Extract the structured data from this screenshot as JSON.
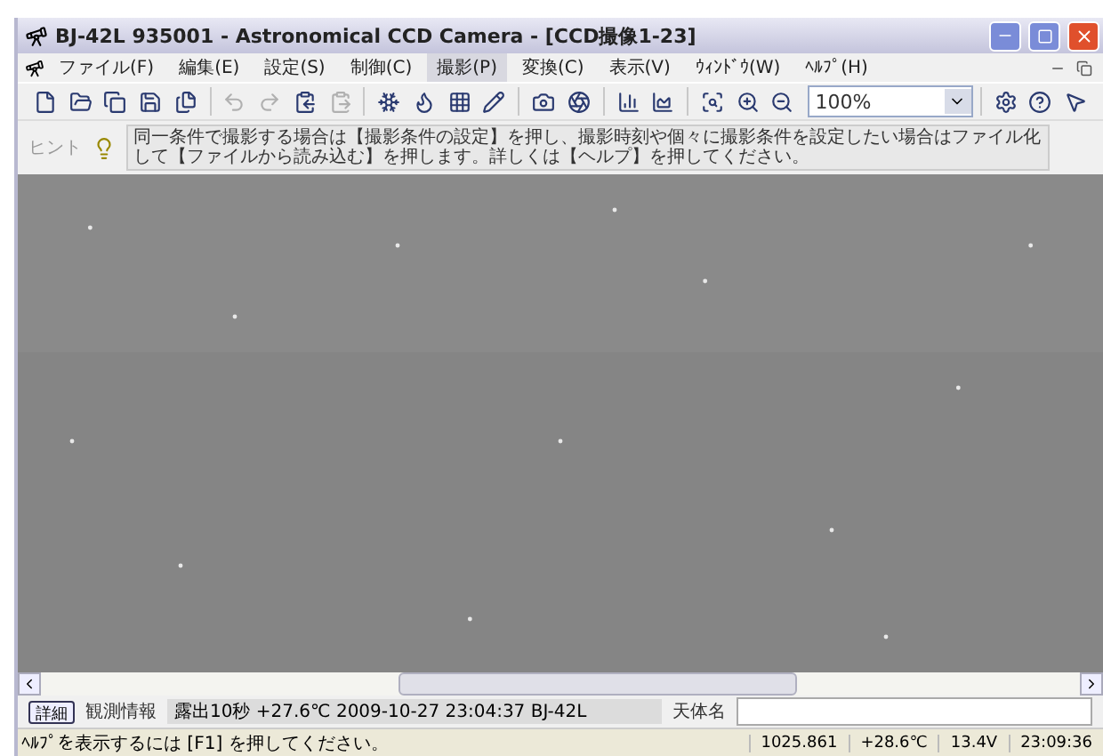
{
  "window": {
    "title": "BJ-42L 935001 - Astronomical CCD Camera - [CCD撮像1-23]"
  },
  "menu": [
    {
      "label": "ファイル(F)",
      "selected": false
    },
    {
      "label": "編集(E)",
      "selected": false
    },
    {
      "label": "設定(S)",
      "selected": false
    },
    {
      "label": "制御(C)",
      "selected": false
    },
    {
      "label": "撮影(P)",
      "selected": true
    },
    {
      "label": "変換(C)",
      "selected": false
    },
    {
      "label": "表示(V)",
      "selected": false
    },
    {
      "label": "ｳｨﾝﾄﾞｳ(W)",
      "selected": false
    },
    {
      "label": "ﾍﾙﾌﾟ(H)",
      "selected": false
    }
  ],
  "toolbar": {
    "buttons": [
      {
        "disabled": false
      },
      {
        "disabled": false
      },
      {
        "disabled": false
      },
      {
        "disabled": false
      },
      {
        "disabled": false
      },
      {
        "disabled": true
      },
      {
        "disabled": true
      },
      {
        "disabled": false
      },
      {
        "disabled": true
      },
      {
        "disabled": false
      },
      {
        "disabled": false
      },
      {
        "disabled": false
      },
      {
        "disabled": false
      },
      {
        "disabled": false
      },
      {
        "disabled": false
      },
      {
        "disabled": false
      },
      {
        "disabled": false
      },
      {
        "disabled": false
      },
      {
        "disabled": false
      },
      {
        "disabled": false
      }
    ],
    "zoom": "100%"
  },
  "hint": {
    "label": "ヒント",
    "text": "同一条件で撮影する場合は【撮影条件の設定】を押し、撮影時刻や個々に撮影条件を設定したい場合はファイル化して【ファイルから読み込む】を押します。詳しくは【ヘルプ】を押してください。"
  },
  "info_bar": {
    "button": "詳細",
    "info_label": "観測情報",
    "info_value": "露出10秒 +27.6℃ 2009-10-27 23:04:37 BJ-42L",
    "object_label": "天体名"
  },
  "status_bar": {
    "help": "ﾍﾙﾌﾟを表示するには [F1] を押してください。",
    "cells": [
      "1025.861",
      "+28.6℃",
      "13.4V",
      "23:09:36"
    ]
  }
}
